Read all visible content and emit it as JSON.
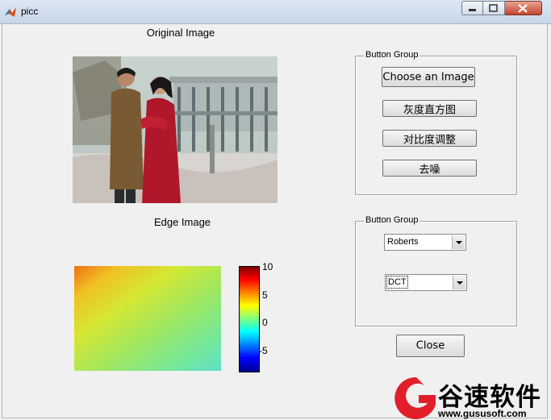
{
  "window": {
    "title": "picc"
  },
  "axes": {
    "original_title": "Original Image",
    "edge_title": "Edge Image"
  },
  "colorbar": {
    "ticks": [
      "10",
      "5",
      "0",
      "-5"
    ]
  },
  "group1": {
    "label": "Button Group",
    "buttons": [
      "Choose an Image",
      "灰度直方图",
      "对比度调整",
      "去噪"
    ]
  },
  "group2": {
    "label": "Button Group",
    "select1": "Roberts",
    "select2": "DCT"
  },
  "close_label": "Close",
  "watermark": {
    "text": "谷速软件",
    "url": "www.gususoft.com"
  }
}
